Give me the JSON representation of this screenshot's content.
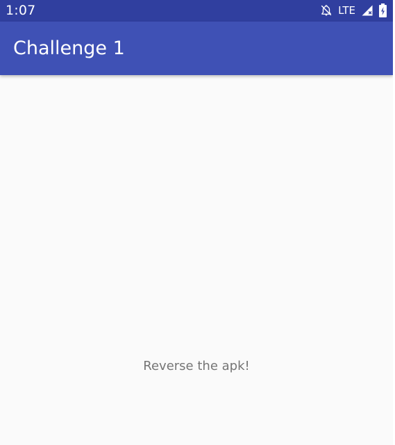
{
  "status_bar": {
    "time": "1:07",
    "network_label": "LTE",
    "icons": [
      "notifications-off-icon",
      "signal-icon",
      "battery-charging-icon"
    ]
  },
  "app_bar": {
    "title": "Challenge 1"
  },
  "main": {
    "message": "Reverse the apk!"
  },
  "colors": {
    "status_bar": "#303f9f",
    "app_bar": "#3f51b5",
    "background": "#fafafa",
    "message_text": "#757575"
  }
}
